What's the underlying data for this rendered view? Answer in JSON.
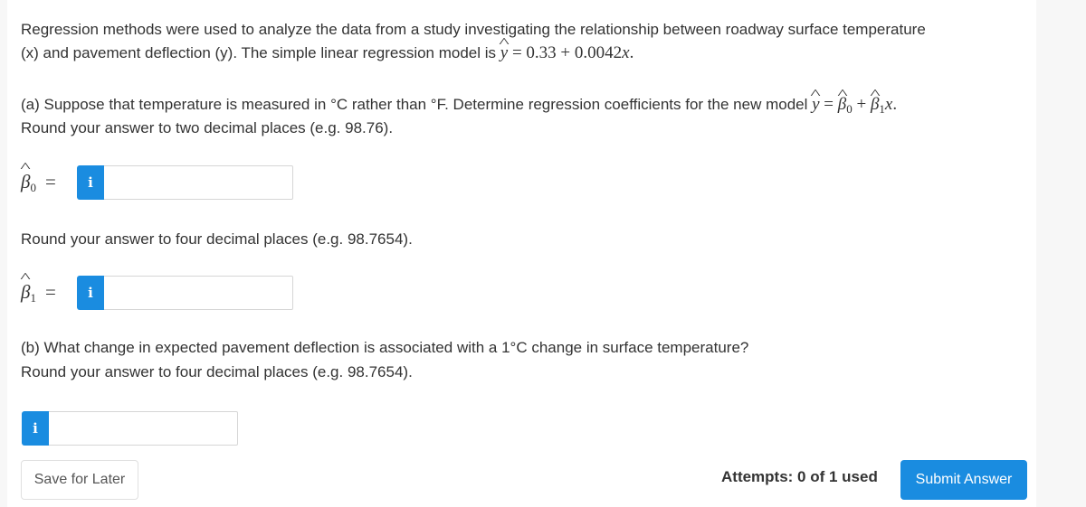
{
  "intro": {
    "line1": "Regression methods were used to analyze the data from a study investigating the relationship between roadway surface temperature",
    "line2_prefix": "(x) and pavement deflection (y). The simple linear regression model is ",
    "model_y": "y",
    "model_rhs": " = 0.33 + 0.0042",
    "model_x": "x",
    "model_end": "."
  },
  "part_a": {
    "line1_prefix": "(a) Suppose that temperature is measured in °C rather than °F. Determine regression coefficients for the new model ",
    "y": "y",
    "eq": " = ",
    "beta": "β",
    "sub0": "0",
    "plus": " + ",
    "sub1": "1",
    "x": "x",
    "end": ".",
    "round_b0": "Round your answer to two decimal places (e.g. 98.76).",
    "round_b1": "Round your answer to four decimal places (e.g. 98.7654).",
    "b0_label_beta": "β",
    "b0_label_sub": "0",
    "b1_label_beta": "β",
    "b1_label_sub": "1",
    "equals": "=",
    "b0_value": "",
    "b1_value": ""
  },
  "part_b": {
    "line1": "(b) What change in expected pavement deflection is associated with a 1°C change in surface temperature?",
    "line2": "Round your answer to four decimal places (e.g. 98.7654).",
    "value": ""
  },
  "info_icon_glyph": "i",
  "footer": {
    "save_label": "Save for Later",
    "attempts": "Attempts: 0 of 1 used",
    "submit_label": "Submit Answer"
  },
  "colors": {
    "accent": "#1a8ce0",
    "text": "#333333"
  }
}
